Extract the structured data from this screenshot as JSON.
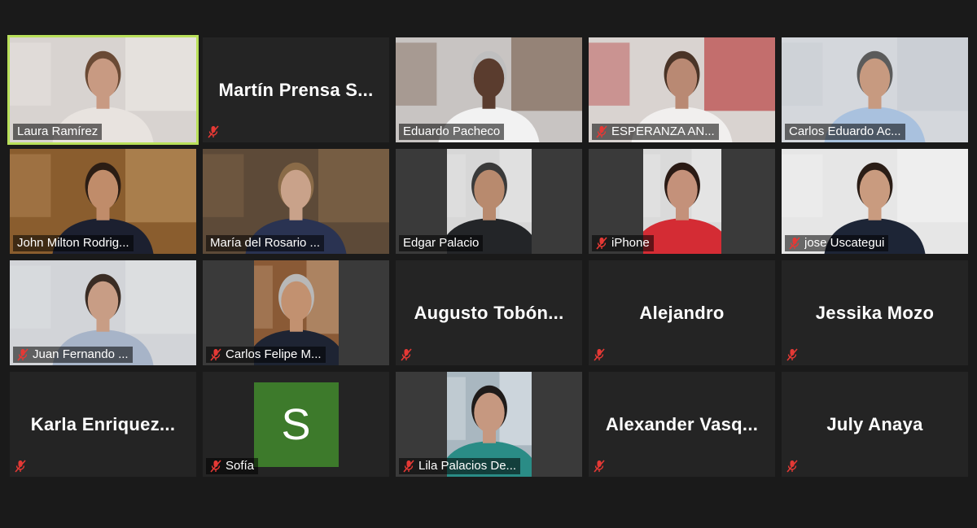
{
  "meeting": {
    "participants": [
      {
        "name": "Laura Ramírez",
        "mode": "video",
        "muted": false,
        "active": true,
        "bg": "#d8d3d0",
        "fg": "#f0ece8",
        "skin": "#c89a82",
        "hair": "#6a4a35",
        "cloth": "#e8e3df"
      },
      {
        "name": "Martín  Prensa  S...",
        "mode": "name",
        "muted": true
      },
      {
        "name": "Eduardo Pacheco",
        "mode": "video",
        "muted": false,
        "bg": "#c8c4c2",
        "fg": "#6b4e3a",
        "skin": "#5a3c2e",
        "hair": "#bfbfbf",
        "cloth": "#f2f2f2"
      },
      {
        "name": "ESPERANZA AN...",
        "mode": "video",
        "muted": true,
        "bg": "#d9d3d0",
        "fg": "#b01c1c",
        "skin": "#b98973",
        "hair": "#4a3427",
        "cloth": "#f1efee"
      },
      {
        "name": "Carlos Eduardo Ac...",
        "mode": "video",
        "muted": false,
        "bg": "#d4d7dc",
        "fg": "#c3c8cf",
        "skin": "#c79a80",
        "hair": "#5b5b5b",
        "cloth": "#a9c1de"
      },
      {
        "name": "John Milton Rodrig...",
        "mode": "video",
        "muted": false,
        "bg": "#8a5d2e",
        "fg": "#c29966",
        "skin": "#c08c6a",
        "hair": "#2b1d14",
        "cloth": "#1c2030"
      },
      {
        "name": "María del Rosario ...",
        "mode": "video",
        "muted": false,
        "bg": "#5d4a38",
        "fg": "#8b6d4d",
        "skin": "#c9a28a",
        "hair": "#8a6b48",
        "cloth": "#2a3352"
      },
      {
        "name": "Edgar Palacio",
        "mode": "video-narrow",
        "muted": false,
        "bg": "#d7d7d7",
        "fg": "#e8e8e8",
        "skin": "#b88a6e",
        "hair": "#3a3a3a",
        "cloth": "#232528"
      },
      {
        "name": "iPhone",
        "mode": "video-narrow",
        "muted": true,
        "bg": "#dadada",
        "fg": "#ececec",
        "skin": "#c4917a",
        "hair": "#2a1a14",
        "cloth": "#d42c34"
      },
      {
        "name": "jose Uscategui",
        "mode": "video",
        "muted": true,
        "bg": "#e6e6e6",
        "fg": "#f4f4f4",
        "skin": "#c99b7f",
        "hair": "#2a1d16",
        "cloth": "#1d2536"
      },
      {
        "name": "Juan Fernando ...",
        "mode": "video",
        "muted": true,
        "bg": "#d2d4d8",
        "fg": "#e3e5e8",
        "skin": "#c89d85",
        "hair": "#3a2c24",
        "cloth": "#a7b4c8"
      },
      {
        "name": "Carlos Felipe M...",
        "mode": "video-narrow",
        "muted": true,
        "bg": "#8a5a36",
        "fg": "#c8a585",
        "skin": "#c29170",
        "hair": "#b8b8b8",
        "cloth": "#1e2433"
      },
      {
        "name": "Augusto  Tobón...",
        "mode": "name",
        "muted": true
      },
      {
        "name": "Alejandro",
        "mode": "name",
        "muted": true
      },
      {
        "name": "Jessika Mozo",
        "mode": "name",
        "muted": true
      },
      {
        "name": "Karla  Enriquez...",
        "mode": "name",
        "muted": true
      },
      {
        "name": "Sofía",
        "mode": "avatar",
        "muted": true,
        "initial": "S"
      },
      {
        "name": "Lila Palacios De...",
        "mode": "video-narrow",
        "muted": true,
        "bg": "#a9b7c0",
        "fg": "#e9eef2",
        "skin": "#c69880",
        "hair": "#1f1b1a",
        "cloth": "#2a8c86"
      },
      {
        "name": "Alexander  Vasq...",
        "mode": "name",
        "muted": true
      },
      {
        "name": "July Anaya",
        "mode": "name",
        "muted": true
      }
    ],
    "colors": {
      "background": "#1a1a1a",
      "tile": "#242424",
      "active_speaker_border": "#b9e05a",
      "muted_icon": "#e53935",
      "avatar_bg": "#3d7a2b"
    }
  }
}
